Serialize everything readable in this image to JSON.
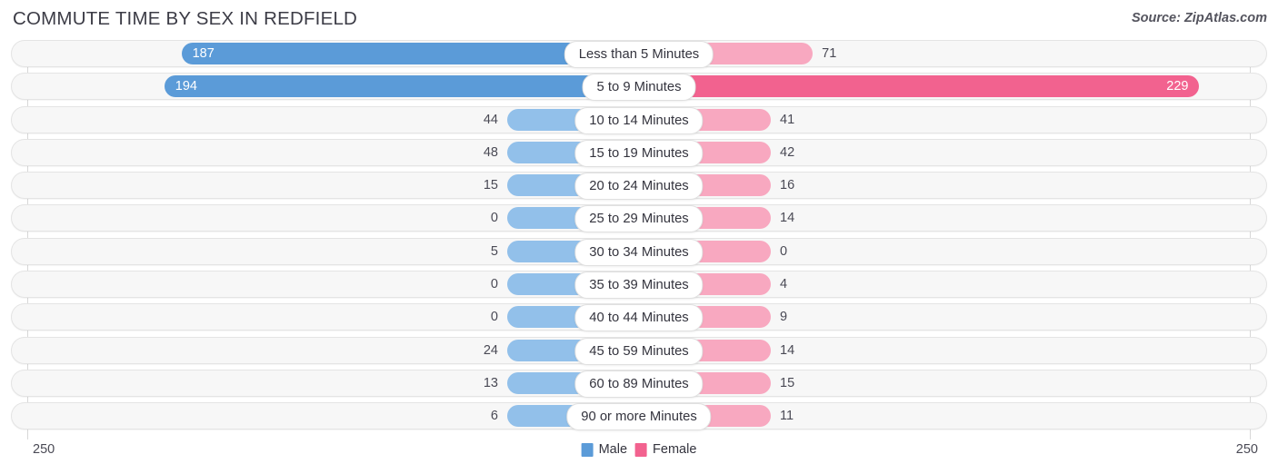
{
  "header": {
    "title": "COMMUTE TIME BY SEX IN REDFIELD",
    "source": "Source: ZipAtlas.com"
  },
  "axis": {
    "left_label": "250",
    "right_label": "250",
    "max": 250
  },
  "legend": {
    "male_label": "Male",
    "female_label": "Female",
    "male_color": "#5b9bd8",
    "female_color": "#f2628f"
  },
  "chart_data": {
    "type": "bar",
    "title": "COMMUTE TIME BY SEX IN REDFIELD",
    "subtitle": "Source: ZipAtlas.com",
    "orientation": "horizontal-diverging",
    "xlabel": "",
    "ylabel": "",
    "xlim": [
      250,
      250
    ],
    "grid": false,
    "legend_position": "bottom-center",
    "categories": [
      "Less than 5 Minutes",
      "5 to 9 Minutes",
      "10 to 14 Minutes",
      "15 to 19 Minutes",
      "20 to 24 Minutes",
      "25 to 29 Minutes",
      "30 to 34 Minutes",
      "35 to 39 Minutes",
      "40 to 44 Minutes",
      "45 to 59 Minutes",
      "60 to 89 Minutes",
      "90 or more Minutes"
    ],
    "series": [
      {
        "name": "Male",
        "color": "#5b9bd8",
        "values": [
          187,
          194,
          44,
          48,
          15,
          0,
          5,
          0,
          0,
          24,
          13,
          6
        ]
      },
      {
        "name": "Female",
        "color": "#f2628f",
        "values": [
          71,
          229,
          41,
          42,
          16,
          14,
          0,
          4,
          9,
          14,
          15,
          11
        ]
      }
    ]
  },
  "rows": [
    {
      "label": "Less than 5 Minutes",
      "male": 187,
      "female": 71,
      "male_text": "187",
      "female_text": "71"
    },
    {
      "label": "5 to 9 Minutes",
      "male": 194,
      "female": 229,
      "male_text": "194",
      "female_text": "229"
    },
    {
      "label": "10 to 14 Minutes",
      "male": 44,
      "female": 41,
      "male_text": "44",
      "female_text": "41"
    },
    {
      "label": "15 to 19 Minutes",
      "male": 48,
      "female": 42,
      "male_text": "48",
      "female_text": "42"
    },
    {
      "label": "20 to 24 Minutes",
      "male": 15,
      "female": 16,
      "male_text": "15",
      "female_text": "16"
    },
    {
      "label": "25 to 29 Minutes",
      "male": 0,
      "female": 14,
      "male_text": "0",
      "female_text": "14"
    },
    {
      "label": "30 to 34 Minutes",
      "male": 5,
      "female": 0,
      "male_text": "5",
      "female_text": "0"
    },
    {
      "label": "35 to 39 Minutes",
      "male": 0,
      "female": 4,
      "male_text": "0",
      "female_text": "4"
    },
    {
      "label": "40 to 44 Minutes",
      "male": 0,
      "female": 9,
      "male_text": "0",
      "female_text": "9"
    },
    {
      "label": "45 to 59 Minutes",
      "male": 24,
      "female": 14,
      "male_text": "24",
      "female_text": "14"
    },
    {
      "label": "60 to 89 Minutes",
      "male": 13,
      "female": 15,
      "male_text": "13",
      "female_text": "15"
    },
    {
      "label": "90 or more Minutes",
      "male": 6,
      "female": 11,
      "male_text": "6",
      "female_text": "11"
    }
  ]
}
